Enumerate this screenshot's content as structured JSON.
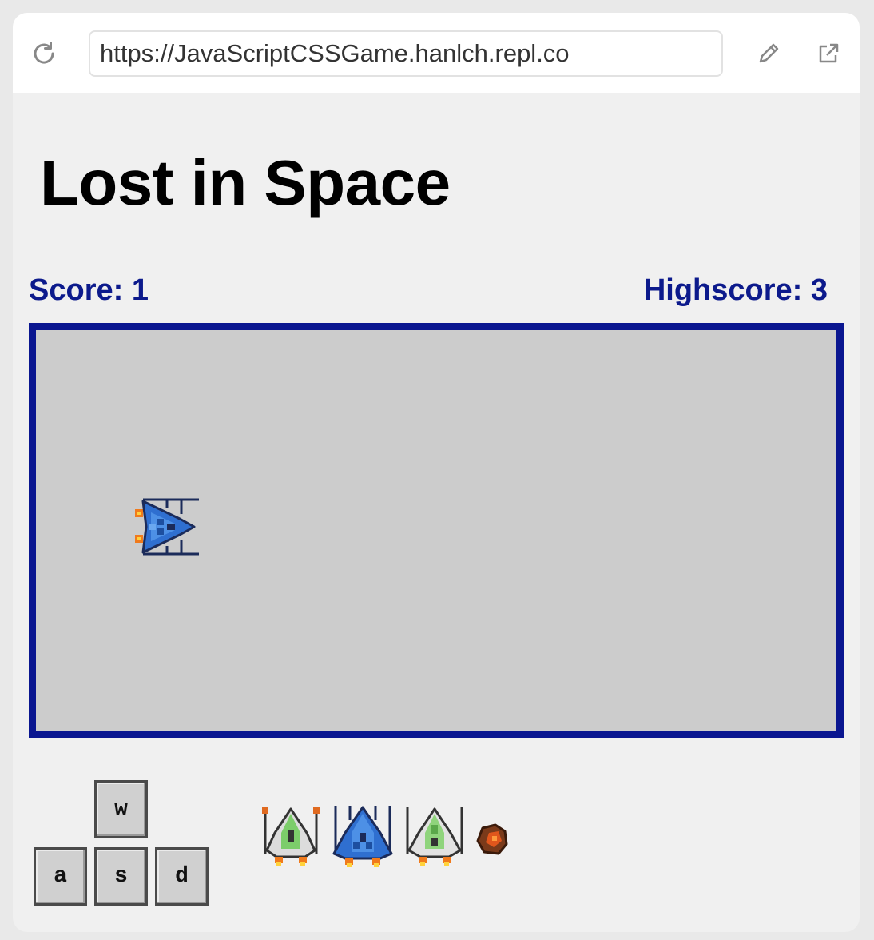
{
  "browser": {
    "url": "https://JavaScriptCSSGame.hanlch.repl.co",
    "icons": [
      "reload-icon",
      "pencil-icon",
      "open-in-new-window-icon"
    ]
  },
  "page": {
    "title": "Lost in Space",
    "score_text": "Score: 1",
    "highscore_text": "Highscore: 3"
  },
  "controls": {
    "keys": [
      "w",
      "a",
      "s",
      "d"
    ]
  },
  "sprites": {
    "player": "blue-spaceship-icon",
    "choices": [
      "green-spaceship-icon",
      "blue-spaceship-icon",
      "green-spaceship-icon",
      "asteroid-icon"
    ]
  },
  "colors": {
    "accent": "#0a1690",
    "text_blue": "#0c1a8c",
    "game_bg": "#cccccc",
    "page_bg": "#f0f0f0"
  }
}
